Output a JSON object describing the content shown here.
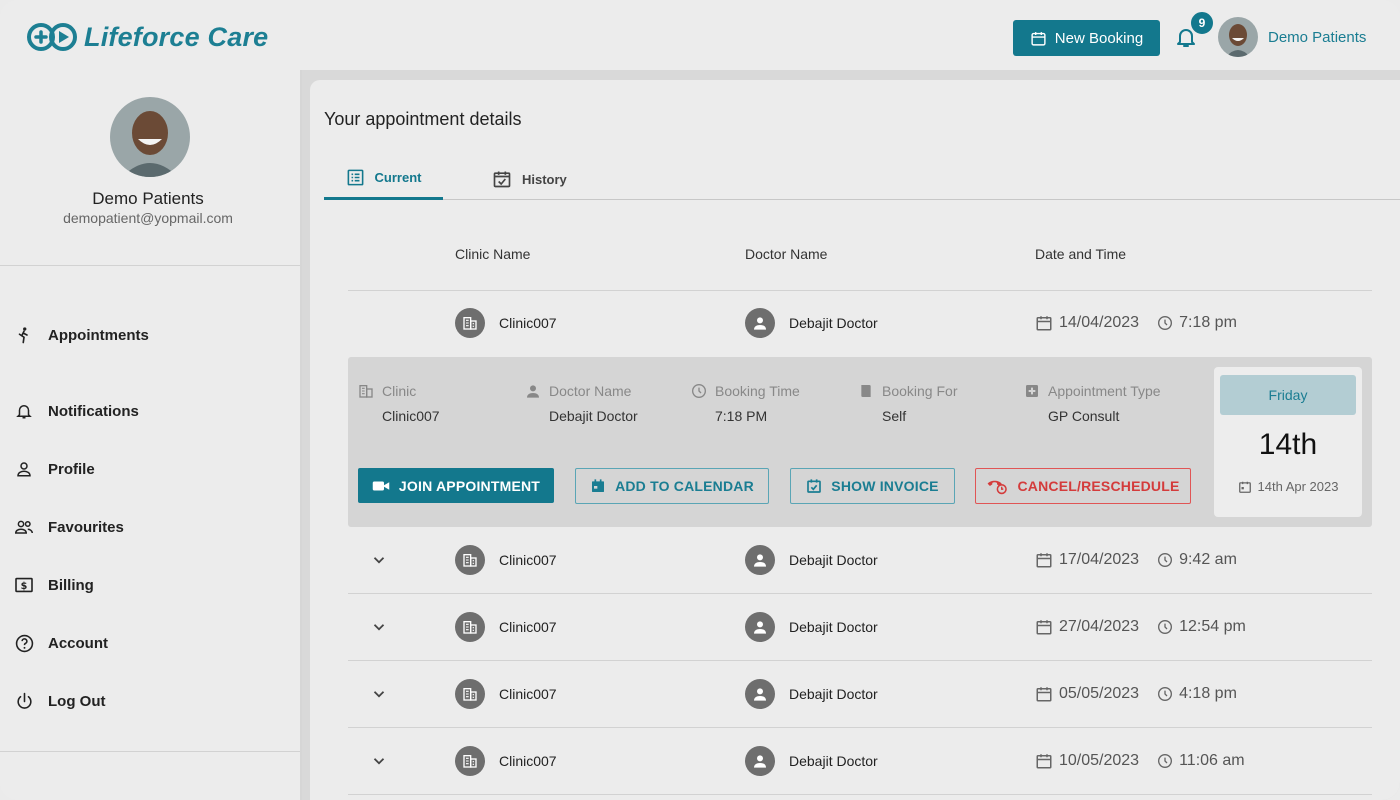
{
  "app": {
    "name": "Lifeforce Care"
  },
  "header": {
    "new_booking_label": "New Booking",
    "notification_count": "9",
    "user_name": "Demo Patients"
  },
  "sidebar": {
    "user_name": "Demo Patients",
    "user_email": "demopatient@yopmail.com",
    "items": [
      {
        "label": "Appointments",
        "icon": "walking-person-icon"
      },
      {
        "label": "Notifications",
        "icon": "bell-icon"
      },
      {
        "label": "Profile",
        "icon": "person-icon"
      },
      {
        "label": "Favourites",
        "icon": "people-icon"
      },
      {
        "label": "Billing",
        "icon": "dollar-icon"
      },
      {
        "label": "Account",
        "icon": "help-circle-icon"
      },
      {
        "label": "Log Out",
        "icon": "power-icon"
      }
    ]
  },
  "main": {
    "title": "Your appointment details",
    "tabs": [
      {
        "label": "Current",
        "active": true
      },
      {
        "label": "History",
        "active": false
      }
    ],
    "columns": [
      "Clinic Name",
      "Doctor Name",
      "Date and Time"
    ],
    "appointments": [
      {
        "clinic": "Clinic007",
        "doctor": "Debajit Doctor",
        "date": "14/04/2023",
        "time": "7:18 pm",
        "expanded": true
      },
      {
        "clinic": "Clinic007",
        "doctor": "Debajit Doctor",
        "date": "17/04/2023",
        "time": "9:42 am",
        "expanded": false
      },
      {
        "clinic": "Clinic007",
        "doctor": "Debajit Doctor",
        "date": "27/04/2023",
        "time": "12:54 pm",
        "expanded": false
      },
      {
        "clinic": "Clinic007",
        "doctor": "Debajit Doctor",
        "date": "05/05/2023",
        "time": "4:18 pm",
        "expanded": false
      },
      {
        "clinic": "Clinic007",
        "doctor": "Debajit Doctor",
        "date": "10/05/2023",
        "time": "11:06 am",
        "expanded": false
      }
    ],
    "detail": {
      "fields": [
        {
          "label": "Clinic",
          "value": "Clinic007"
        },
        {
          "label": "Doctor Name",
          "value": "Debajit Doctor"
        },
        {
          "label": "Booking Time",
          "value": "7:18 PM"
        },
        {
          "label": "Booking For",
          "value": "Self"
        },
        {
          "label": "Appointment Type",
          "value": "GP Consult"
        }
      ],
      "buttons": {
        "join": "JOIN APPOINTMENT",
        "calendar": "ADD TO CALENDAR",
        "invoice": "SHOW INVOICE",
        "cancel": "CANCEL/RESCHEDULE"
      },
      "date_card": {
        "weekday": "Friday",
        "day": "14th",
        "full_date": "14th Apr 2023"
      }
    }
  },
  "colors": {
    "brand": "#13788d",
    "danger": "#d43b3b",
    "background": "#ececec"
  }
}
